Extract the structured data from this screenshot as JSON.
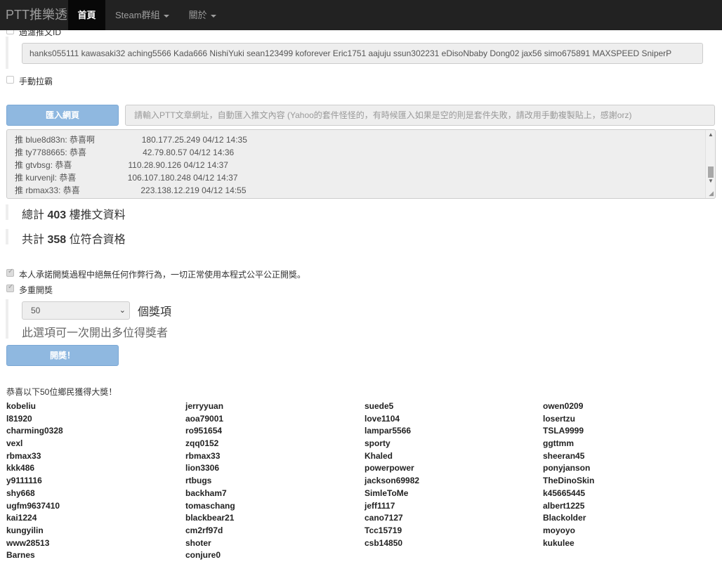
{
  "navbar": {
    "brand": "PTT推樂透",
    "home": "首頁",
    "steam": "Steam群組",
    "about": "關於"
  },
  "exclude_label": "過濾推文ID",
  "exclude_ids": "hanks055111 kawasaki32 aching5566 Kada666 NishiYuki sean123499 koforever Eric1751 aajuju ssun302231 eDisoNbaby Dong02 jax56 simo675891 MAXSPEED SniperP",
  "manual_label": "手動拉霸",
  "import_button": "匯入網頁",
  "url_placeholder": "請輸入PTT文章網址，自動匯入推文內容 (Yahoo的套件怪怪的，有時候匯入如果是空的則是套件失敗，請改用手動複製貼上，感謝orz)",
  "push_lines": [
    "推 blue8d83n: 恭喜啊                    180.177.25.249 04/12 14:35",
    "推 ty7788665: 恭喜                        42.79.80.57 04/12 14:36",
    "推 gtvbsg: 恭喜                        110.28.90.126 04/12 14:37",
    "推 kurvenjl: 恭喜                      106.107.180.248 04/12 14:37",
    "推 rbmax33: 恭喜                          223.138.12.219 04/12 14:55"
  ],
  "stats": {
    "total_prefix": "總計",
    "total_count": "403",
    "total_suffix": "樓推文資料",
    "qualified_prefix": "共計",
    "qualified_count": "358",
    "qualified_suffix": "位符合資格"
  },
  "promise_label": "本人承諾開獎過程中絕無任何作弊行為，一切正常使用本程式公平公正開獎。",
  "multi_label": "多重開獎",
  "prize_count": "50",
  "prize_suffix": "個獎項",
  "prize_help": "此選項可一次開出多位得獎者",
  "draw_button": "開獎！",
  "congrats_text": "恭喜以下50位鄉民獲得大獎！",
  "winners": [
    [
      "kobeliu",
      "l81920",
      "charming0328",
      "vexl",
      "rbmax33",
      "kkk486",
      "y9111116",
      "shy668",
      "ugfm9637410",
      "kai1224",
      "kungyilin",
      "www28513",
      "Barnes"
    ],
    [
      "jerryyuan",
      "aoa79001",
      "ro951654",
      "zqq0152",
      "rbmax33",
      "lion3306",
      "rtbugs",
      "backham7",
      "tomaschang",
      "blackbear21",
      "cm2rf97d",
      "shoter",
      "conjure0"
    ],
    [
      "suede5",
      "love1104",
      "lampar5566",
      "sporty",
      "Khaled",
      "powerpower",
      "jackson69982",
      "SimleToMe",
      "jeff1117",
      "cano7127",
      "Tcc15719",
      "csb14850"
    ],
    [
      "owen0209",
      "losertzu",
      "TSLA9999",
      "ggttmm",
      "sheeran45",
      "ponyjanson",
      "TheDinoSkin",
      "k45665445",
      "albert1225",
      "Blackolder",
      "moyoyo",
      "kukulee"
    ]
  ]
}
